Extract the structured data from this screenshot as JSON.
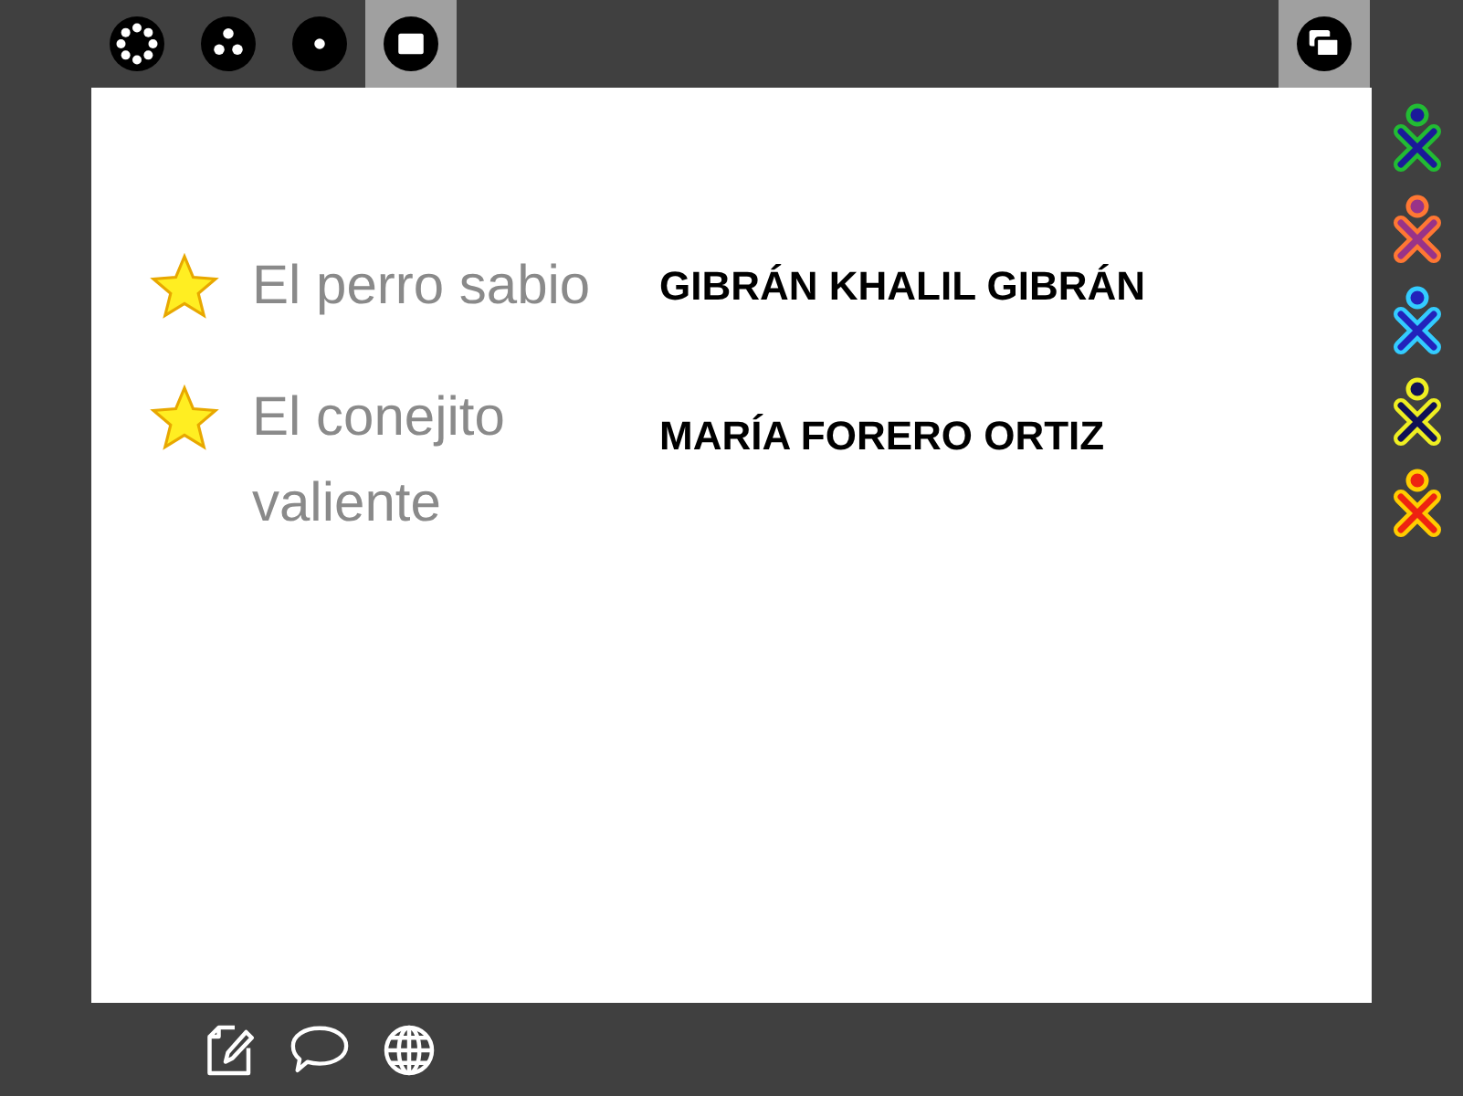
{
  "zoom_views": [
    {
      "kind": "neighborhood",
      "selected": false
    },
    {
      "kind": "group",
      "selected": false
    },
    {
      "kind": "home",
      "selected": false
    },
    {
      "kind": "activity",
      "selected": true
    }
  ],
  "fullscreen_button": {
    "selected": true
  },
  "books": [
    {
      "title": "El perro sabio",
      "author": "GIBRÁN KHALIL GIBRÁN"
    },
    {
      "title": "El conejito valiente",
      "author": "MARÍA FORERO ORTIZ"
    }
  ],
  "buddies": [
    {
      "color": "#22bb33",
      "center": {
        "color": "#1a1a99"
      }
    },
    {
      "color": "#ff7733",
      "center": {
        "color": "#993388"
      }
    },
    {
      "color": "#33ccff",
      "center": {
        "color": "#2222bb"
      }
    },
    {
      "color": "#eeee22",
      "center": {
        "color": "#111155"
      }
    },
    {
      "color": "#ffcc00",
      "center": {
        "color": "#ee2211"
      }
    }
  ],
  "bottom_tools": [
    {
      "kind": "journal"
    },
    {
      "kind": "chat"
    },
    {
      "kind": "web"
    }
  ]
}
